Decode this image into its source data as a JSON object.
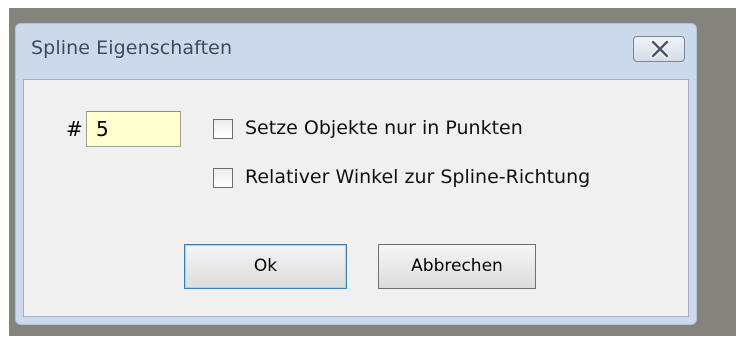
{
  "window": {
    "title": "Spline Eigenschaften",
    "close_icon": "close-x-icon"
  },
  "count": {
    "label": "#",
    "value": "5"
  },
  "options": [
    {
      "label": "Setze Objekte nur in Punkten",
      "checked": false
    },
    {
      "label": "Relativer Winkel zur Spline-Richtung",
      "checked": false
    }
  ],
  "buttons": {
    "ok": "Ok",
    "cancel": "Abbrechen"
  },
  "colors": {
    "titlebar": "#cbd9ea",
    "client": "#f0f0f0",
    "input_bg": "#ffffcf",
    "desktop": "#84847b"
  }
}
